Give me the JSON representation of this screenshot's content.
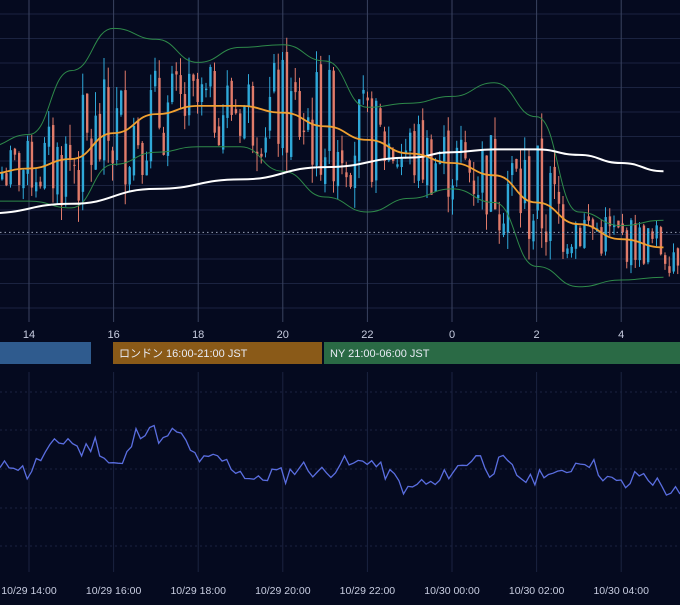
{
  "colors": {
    "background": "#050a1f",
    "grid_minor": "#1b2340",
    "grid_major": "#3a4360",
    "candle_up": "#2fa8d8",
    "candle_down": "#e07b6a",
    "ma_short": "#f0a030",
    "ma_long": "#ffffff",
    "bollinger": "#2e8a4a",
    "oscillator": "#5a6ee0",
    "price_line": "#9aa3b8",
    "label_text": "#c8cde0",
    "session_tokyo": "#2f5b8e",
    "session_london": "#8a5a18",
    "session_ny": "#2a6a45"
  },
  "sessions": [
    {
      "label": "",
      "name": "tokyo"
    },
    {
      "label": "ロンドン 16:00-21:00 JST",
      "name": "london"
    },
    {
      "label": "NY 21:00-06:00 JST",
      "name": "ny"
    }
  ],
  "time_axis": {
    "main_ticks": [
      "14",
      "16",
      "18",
      "20",
      "22",
      "0",
      "2",
      "4"
    ],
    "date_ticks": [
      "10/29 14:00",
      "10/29 16:00",
      "10/29 18:00",
      "10/29 20:00",
      "10/29 22:00",
      "10/30 00:00",
      "10/30 02:00",
      "10/30 04:00"
    ]
  },
  "chart_data": [
    {
      "type": "candlestick",
      "title": "",
      "indicators": [
        "moving average (orange)",
        "moving average (white)",
        "bollinger bands (green)"
      ],
      "x_ticks": [
        "14",
        "16",
        "18",
        "20",
        "22",
        "0",
        "2",
        "4"
      ],
      "y_ticks": [],
      "overlays": {
        "ma_short": [
          {
            "x": "13:00",
            "y": 0.23
          },
          {
            "x": "14:00",
            "y": 0.27
          },
          {
            "x": "15:00",
            "y": 0.34
          },
          {
            "x": "16:00",
            "y": 0.53
          },
          {
            "x": "17:00",
            "y": 0.67
          },
          {
            "x": "18:00",
            "y": 0.73
          },
          {
            "x": "19:00",
            "y": 0.73
          },
          {
            "x": "20:00",
            "y": 0.68
          },
          {
            "x": "21:00",
            "y": 0.58
          },
          {
            "x": "22:00",
            "y": 0.48
          },
          {
            "x": "23:00",
            "y": 0.38
          },
          {
            "x": "00:00",
            "y": 0.31
          },
          {
            "x": "01:00",
            "y": 0.22
          },
          {
            "x": "02:00",
            "y": 0.02
          },
          {
            "x": "03:00",
            "y": -0.14
          },
          {
            "x": "04:00",
            "y": -0.25
          },
          {
            "x": "05:00",
            "y": -0.31
          }
        ],
        "ma_long": [
          {
            "x": "13:00",
            "y": -0.06
          },
          {
            "x": "15:00",
            "y": 0.01
          },
          {
            "x": "17:00",
            "y": 0.12
          },
          {
            "x": "19:00",
            "y": 0.19
          },
          {
            "x": "21:00",
            "y": 0.28
          },
          {
            "x": "23:00",
            "y": 0.35
          },
          {
            "x": "00:00",
            "y": 0.39
          },
          {
            "x": "01:00",
            "y": 0.41
          },
          {
            "x": "02:00",
            "y": 0.41
          },
          {
            "x": "03:00",
            "y": 0.37
          },
          {
            "x": "04:00",
            "y": 0.31
          },
          {
            "x": "05:00",
            "y": 0.25
          }
        ]
      },
      "bollinger_upper": [
        {
          "x": "13:00",
          "y": 0.43
        },
        {
          "x": "14:00",
          "y": 0.52
        },
        {
          "x": "15:00",
          "y": 0.99
        },
        {
          "x": "16:00",
          "y": 1.3
        },
        {
          "x": "17:00",
          "y": 1.22
        },
        {
          "x": "18:00",
          "y": 1.05
        },
        {
          "x": "19:00",
          "y": 1.16
        },
        {
          "x": "20:00",
          "y": 1.18
        },
        {
          "x": "21:00",
          "y": 1.06
        },
        {
          "x": "22:00",
          "y": 0.72
        },
        {
          "x": "23:00",
          "y": 0.75
        },
        {
          "x": "00:00",
          "y": 0.8
        },
        {
          "x": "01:00",
          "y": 0.9
        },
        {
          "x": "02:00",
          "y": 0.65
        },
        {
          "x": "03:00",
          "y": -0.05
        },
        {
          "x": "04:00",
          "y": -0.15
        },
        {
          "x": "05:00",
          "y": -0.11
        }
      ],
      "bollinger_lower": [
        {
          "x": "13:00",
          "y": 0.03
        },
        {
          "x": "14:00",
          "y": 0.03
        },
        {
          "x": "15:00",
          "y": -0.02
        },
        {
          "x": "16:00",
          "y": 0.3
        },
        {
          "x": "17:00",
          "y": 0.39
        },
        {
          "x": "18:00",
          "y": 0.43
        },
        {
          "x": "19:00",
          "y": 0.43
        },
        {
          "x": "20:00",
          "y": 0.25
        },
        {
          "x": "21:00",
          "y": 0.06
        },
        {
          "x": "22:00",
          "y": -0.05
        },
        {
          "x": "23:00",
          "y": 0.05
        },
        {
          "x": "00:00",
          "y": 0.12
        },
        {
          "x": "01:00",
          "y": 0.02
        },
        {
          "x": "02:00",
          "y": -0.45
        },
        {
          "x": "03:00",
          "y": -0.6
        },
        {
          "x": "04:00",
          "y": -0.55
        },
        {
          "x": "05:00",
          "y": -0.53
        }
      ],
      "reference_level": -0.2
    },
    {
      "type": "line",
      "title": "",
      "series": [
        {
          "values": [
            46,
            50,
            44,
            52,
            58,
            62,
            55,
            60,
            50,
            48,
            64,
            68,
            60,
            66,
            55,
            50,
            52,
            48,
            44,
            40,
            45,
            43,
            48,
            46,
            44,
            50,
            48,
            52,
            46,
            42,
            35,
            40,
            38,
            45,
            48,
            54,
            46,
            50,
            44,
            40,
            46,
            42,
            48,
            52,
            46,
            40,
            38,
            44,
            41,
            36,
            34
          ]
        }
      ],
      "x_ticks": [
        "10/29 14:00",
        "10/29 16:00",
        "10/29 18:00",
        "10/29 20:00",
        "10/29 22:00",
        "10/30 00:00",
        "10/30 02:00",
        "10/30 04:00"
      ]
    }
  ]
}
